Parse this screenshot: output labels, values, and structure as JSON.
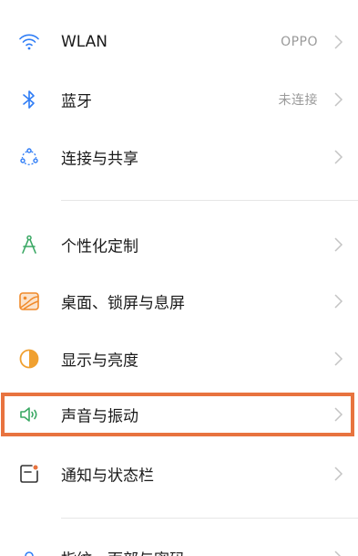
{
  "colors": {
    "accent_highlight": "#e8733f",
    "wlan_icon": "#2f7df6",
    "bluetooth_icon": "#2f7df6",
    "share_icon": "#2f7df6",
    "personalize_icon": "#3aa864",
    "wallpaper_icon": "#f08a2b",
    "display_icon": "#f0a030",
    "sound_icon": "#3aa864",
    "notification_icon": "#2f7df6"
  },
  "settings": {
    "wlan": {
      "label": "WLAN",
      "value": "OPPO",
      "icon": "wifi-icon"
    },
    "bluetooth": {
      "label": "蓝牙",
      "value": "未连接",
      "icon": "bluetooth-icon"
    },
    "share": {
      "label": "连接与共享",
      "icon": "connection-share-icon"
    },
    "personalize": {
      "label": "个性化定制",
      "icon": "compass-icon"
    },
    "wallpaper": {
      "label": "桌面、锁屏与息屏",
      "icon": "wallpaper-icon"
    },
    "display": {
      "label": "显示与亮度",
      "icon": "brightness-icon"
    },
    "sound": {
      "label": "声音与振动",
      "icon": "speaker-icon"
    },
    "notification": {
      "label": "通知与状态栏",
      "icon": "notification-bar-icon"
    },
    "next": {
      "label": "指纹、面部与密码",
      "icon": "lock-icon"
    }
  }
}
